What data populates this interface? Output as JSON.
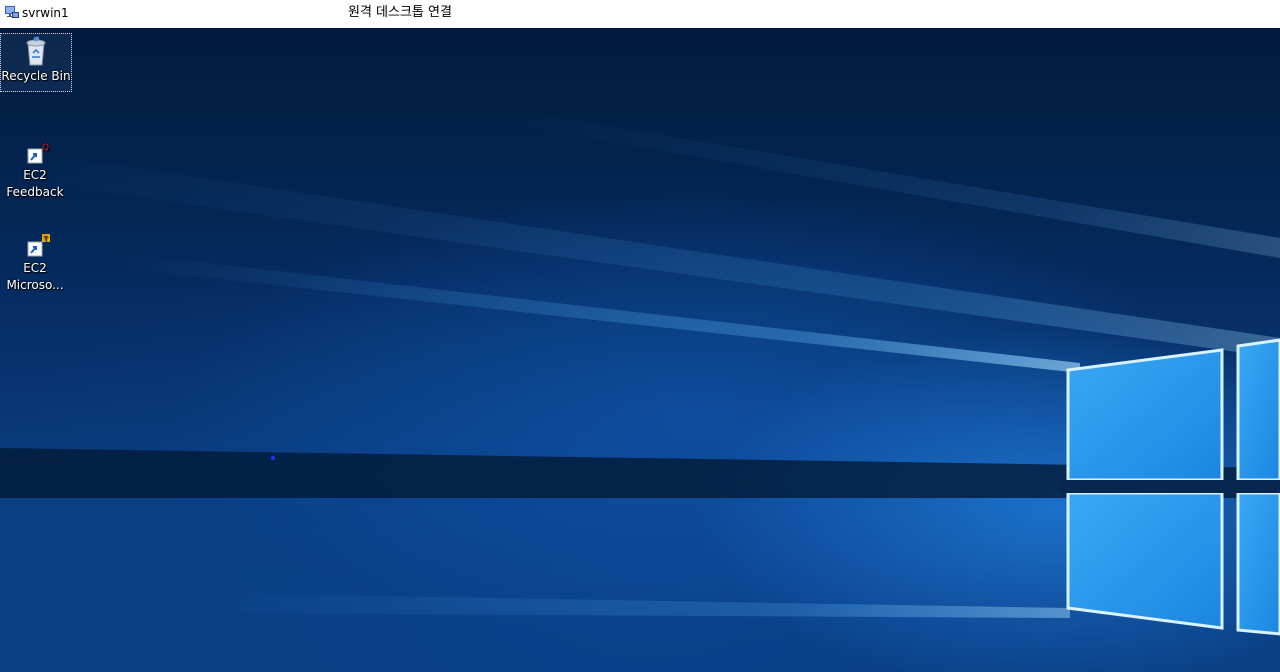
{
  "titlebar": {
    "window_title": "svrwin1",
    "app_title": "원격 데스크톱 연결",
    "icon": "remote-desktop-icon"
  },
  "desktop": {
    "icons": [
      {
        "label": "Recycle Bin",
        "icon": "recycle-bin-icon",
        "selected": true
      },
      {
        "label_line1": "EC2",
        "label_line2": "Feedback",
        "icon": "ec2-feedback-shortcut-icon"
      },
      {
        "label_line1": "EC2",
        "label_line2": "Microso...",
        "icon": "ec2-microsoft-shortcut-icon"
      }
    ]
  },
  "colors": {
    "titlebar_bg": "#ffffff",
    "desktop_dark": "#021a3d",
    "desktop_light_blue": "#2e9cff"
  }
}
